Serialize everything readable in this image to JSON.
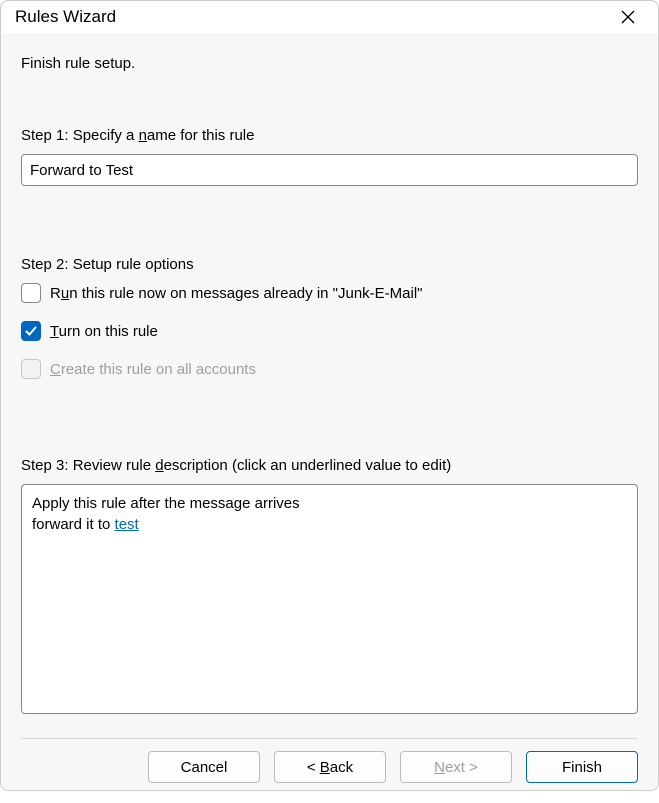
{
  "titlebar": {
    "title": "Rules Wizard"
  },
  "heading": "Finish rule setup.",
  "step1": {
    "label_pre": "Step 1: Specify a ",
    "label_u": "n",
    "label_post": "ame for this rule",
    "value": "Forward to Test"
  },
  "step2": {
    "label": "Step 2: Setup rule options",
    "opt1_pre": "R",
    "opt1_u": "u",
    "opt1_post": "n this rule now on messages already in \"Junk-E-Mail\"",
    "opt2_u": "T",
    "opt2_post": "urn on this rule",
    "opt3_u": "C",
    "opt3_post": "reate this rule on all accounts"
  },
  "step3": {
    "label_pre": "Step 3: Review rule ",
    "label_u": "d",
    "label_post": "escription (click an underlined value to edit)",
    "line1": "Apply this rule after the message arrives",
    "line2_pre": "forward it to ",
    "line2_link": "test"
  },
  "footer": {
    "cancel": "Cancel",
    "back_pre": "< ",
    "back_u": "B",
    "back_post": "ack",
    "next_u": "N",
    "next_post": "ext >",
    "finish": "Finish"
  }
}
